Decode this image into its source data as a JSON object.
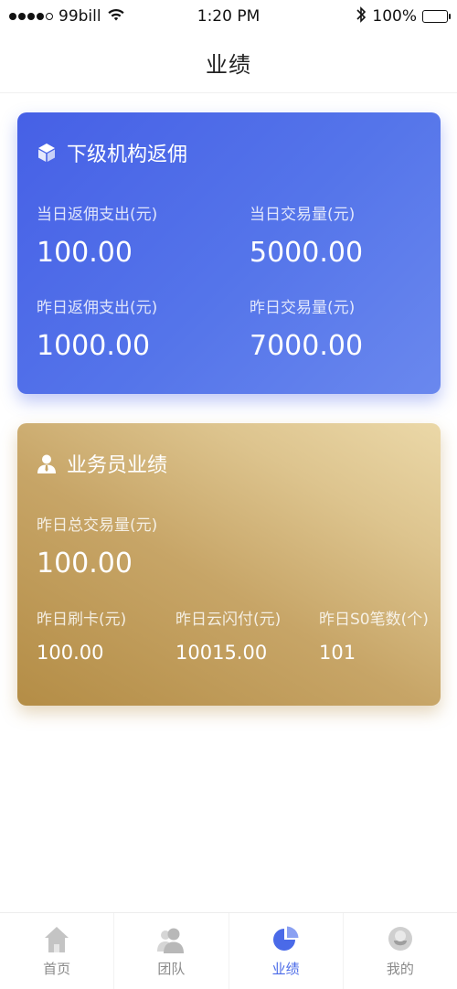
{
  "status_bar": {
    "carrier": "99bill",
    "time": "1:20 PM",
    "battery": "100%",
    "icons": [
      "signal-dots-icon",
      "wifi-icon",
      "bluetooth-icon",
      "battery-icon"
    ]
  },
  "nav": {
    "title": "业绩"
  },
  "rebate_card": {
    "title": "下级机构返佣",
    "icon": "cube-icon",
    "metrics": [
      {
        "label": "当日返佣支出(元)",
        "value": "100.00"
      },
      {
        "label": "当日交易量(元)",
        "value": "5000.00"
      },
      {
        "label": "昨日返佣支出(元)",
        "value": "1000.00"
      },
      {
        "label": "昨日交易量(元)",
        "value": "7000.00"
      }
    ]
  },
  "salesman_card": {
    "title": "业务员业绩",
    "icon": "person-icon",
    "total": {
      "label": "昨日总交易量(元)",
      "value": "100.00"
    },
    "metrics": [
      {
        "label": "昨日刷卡(元)",
        "value": "100.00"
      },
      {
        "label": "昨日云闪付(元)",
        "value": "10015.00"
      },
      {
        "label": "昨日S0笔数(个)",
        "value": "101"
      }
    ]
  },
  "tab_bar": {
    "tabs": [
      {
        "label": "首页",
        "icon": "home-icon",
        "active": false
      },
      {
        "label": "团队",
        "icon": "team-icon",
        "active": false
      },
      {
        "label": "业绩",
        "icon": "pie-chart-icon",
        "active": true
      },
      {
        "label": "我的",
        "icon": "profile-icon",
        "active": false
      }
    ]
  },
  "colors": {
    "blue_card": "#4660e6",
    "gold_card": "#c7a567",
    "active_tab": "#4a6ae8",
    "inactive_tab": "#b5b5b5"
  }
}
